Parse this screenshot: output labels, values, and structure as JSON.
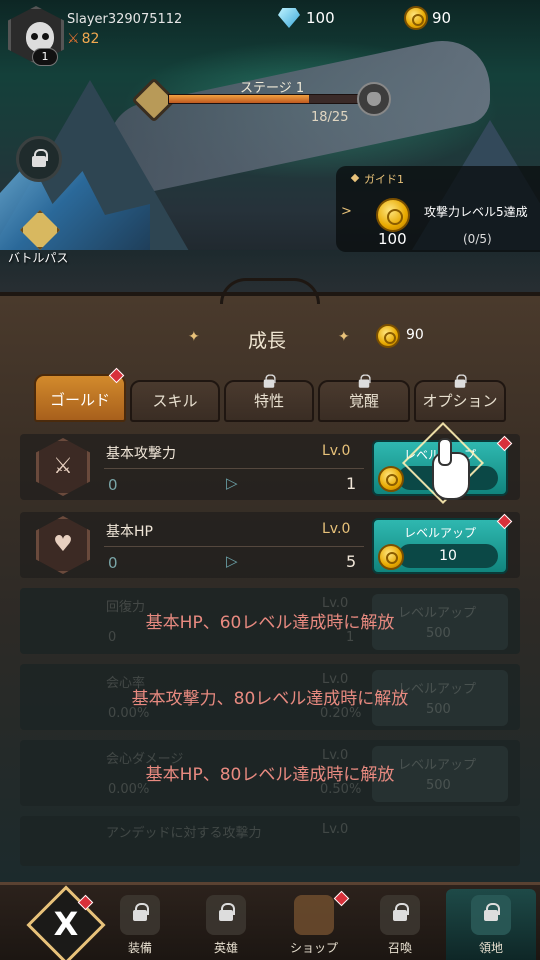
{
  "player": {
    "name": "Slayer329075112",
    "level": "1",
    "power": "82"
  },
  "resources": {
    "gems": "100",
    "gold": "90"
  },
  "stage": {
    "title": "ステージ 1",
    "progress_text": "18/25",
    "progress": 0.72
  },
  "side": {
    "battlepass_label": "バトルパス"
  },
  "guide": {
    "title": "ガイド1",
    "reward": "100",
    "task": "攻撃力レベル5達成",
    "progress_text": "(0/5)"
  },
  "panel": {
    "title": "成長",
    "gold": "90",
    "tabs": [
      {
        "label": "ゴールド",
        "active": true,
        "locked": false,
        "badge": true
      },
      {
        "label": "スキル",
        "active": false,
        "locked": false,
        "badge": false
      },
      {
        "label": "特性",
        "active": false,
        "locked": true,
        "badge": false
      },
      {
        "label": "覚醒",
        "active": false,
        "locked": true,
        "badge": false
      },
      {
        "label": "オプション",
        "active": false,
        "locked": true,
        "badge": false
      }
    ]
  },
  "rows": [
    {
      "name": "基本攻撃力",
      "level": "Lv.0",
      "current": "0",
      "next": "1",
      "button_label": "レベルアップ",
      "cost": "1",
      "icon": "crossed-swords-icon"
    },
    {
      "name": "基本HP",
      "level": "Lv.0",
      "current": "0",
      "next": "5",
      "button_label": "レベルアップ",
      "cost": "10",
      "icon": "heart-plus-icon"
    }
  ],
  "locked_rows": [
    {
      "name": "回復力",
      "level": "Lv.0",
      "current": "0",
      "next": "1",
      "button_label": "レベルアップ",
      "cost": "500",
      "message": "基本HP、60レベル達成時に解放"
    },
    {
      "name": "会心率",
      "level": "Lv.0",
      "current": "0.00%",
      "next": "0.20%",
      "button_label": "レベルアップ",
      "cost": "500",
      "message": "基本攻撃力、80レベル達成時に解放"
    },
    {
      "name": "会心ダメージ",
      "level": "Lv.0",
      "current": "0.00%",
      "next": "0.50%",
      "button_label": "レベルアップ",
      "cost": "500",
      "message": "基本HP、80レベル達成時に解放"
    },
    {
      "name": "アンデッドに対する攻撃力",
      "level": "Lv.0",
      "current": "",
      "next": "",
      "button_label": "",
      "cost": "",
      "message": ""
    }
  ],
  "nav": [
    {
      "label": "",
      "icon": "x-emblem-icon"
    },
    {
      "label": "装備",
      "icon": "helmet-icon"
    },
    {
      "label": "英雄",
      "icon": "hero-icon"
    },
    {
      "label": "ショップ",
      "icon": "shop-cart-icon"
    },
    {
      "label": "召喚",
      "icon": "summon-cards-icon"
    },
    {
      "label": "領地",
      "icon": "territory-gate-icon"
    }
  ]
}
